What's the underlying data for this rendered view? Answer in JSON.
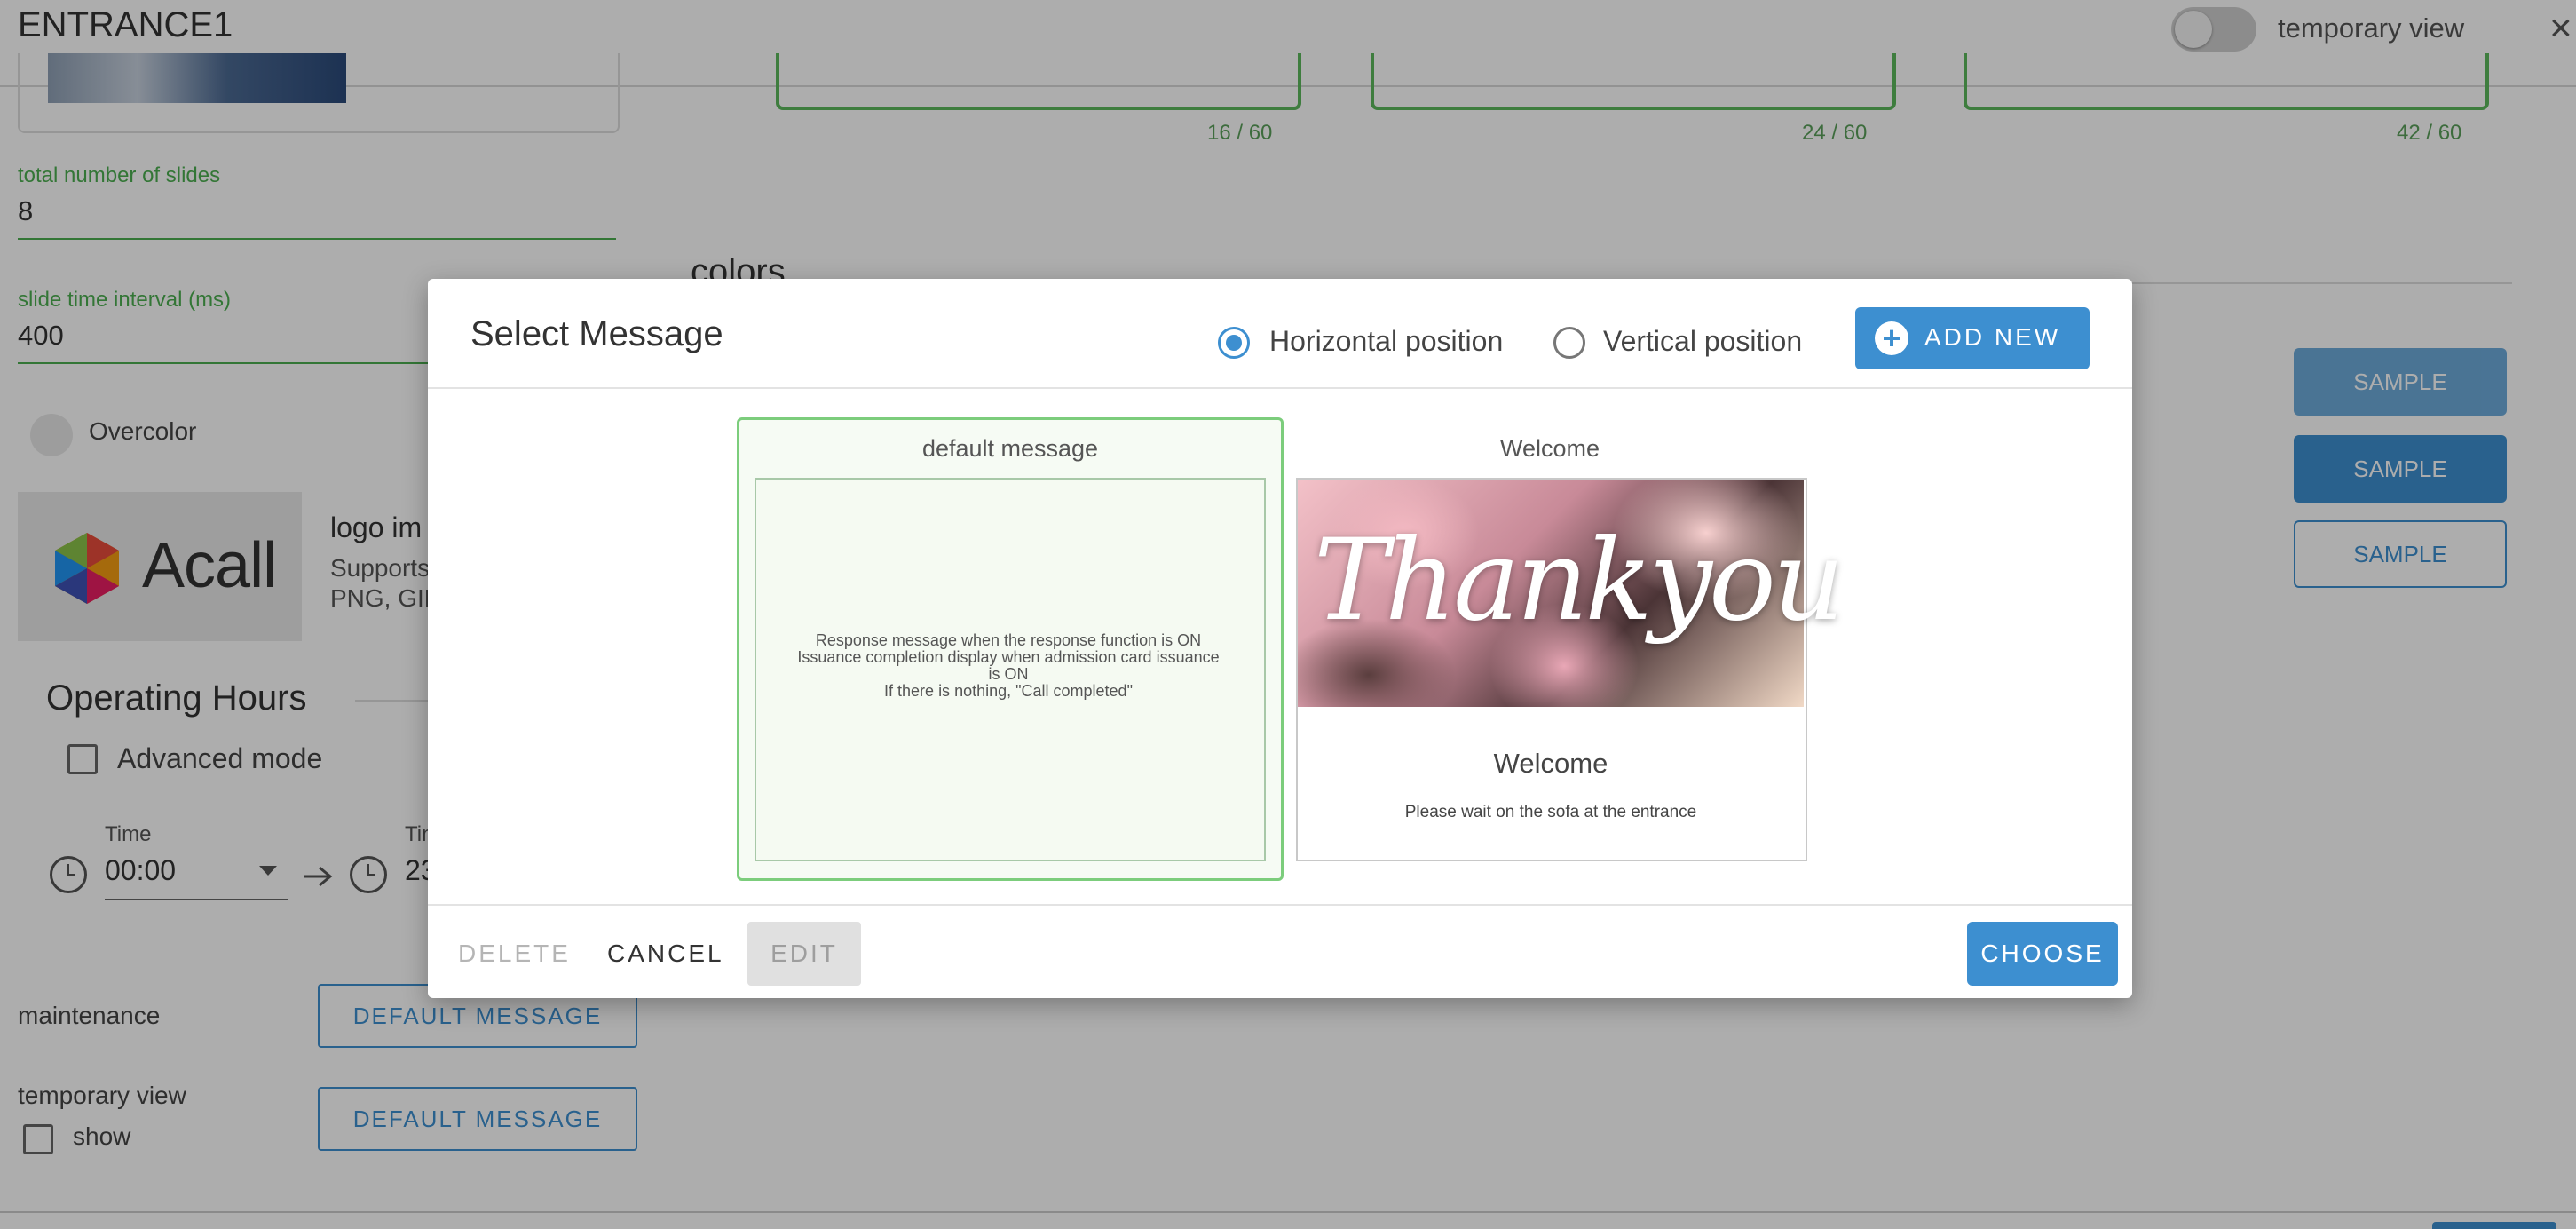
{
  "header": {
    "title": "ENTRANCE1",
    "temporary_view_label": "temporary view",
    "close_icon": "×"
  },
  "text_counters": [
    "16 / 60",
    "24 / 60",
    "42 / 60"
  ],
  "slides": {
    "total_label": "total number of slides",
    "total_value": "8",
    "interval_label": "slide time interval (ms)",
    "interval_value": "400"
  },
  "overcolor_label": "Overcolor",
  "logo": {
    "brand_text": "Acall",
    "image_label": "logo im",
    "supports_line1": "Supports",
    "supports_line2": "PNG, GIF"
  },
  "operating_hours": {
    "title": "Operating Hours",
    "advanced_mode_label": "Advanced mode",
    "start_label": "Time",
    "start_value": "00:00",
    "end_label": "Tin",
    "end_value": "23"
  },
  "maintenance": {
    "label": "maintenance",
    "button": "DEFAULT MESSAGE"
  },
  "temporary_view": {
    "label": "temporary view",
    "show_label": "show",
    "button": "DEFAULT MESSAGE"
  },
  "colors_peek": "colors",
  "samples": [
    "SAMPLE",
    "SAMPLE",
    "SAMPLE"
  ],
  "modal": {
    "title": "Select Message",
    "horizontal_label": "Horizontal position",
    "vertical_label": "Vertical position",
    "horizontal_selected": true,
    "add_new_label": "ADD NEW",
    "cards": [
      {
        "title": "default message",
        "lines": [
          "Response message when the response function is ON",
          "Issuance completion display when admission card issuance",
          "is ON",
          "If there is nothing, \"Call completed\""
        ]
      },
      {
        "title": "Welcome",
        "image_text": "Thankyou",
        "heading": "Welcome",
        "subtext": "Please wait on the sofa at the entrance"
      }
    ],
    "footer": {
      "delete": "DELETE",
      "cancel": "CANCEL",
      "edit": "EDIT",
      "choose": "CHOOSE"
    }
  },
  "colors": {
    "accent": "#3d8fd0",
    "success": "#4caf50",
    "overlay": "rgba(0,0,0,0.32)"
  }
}
